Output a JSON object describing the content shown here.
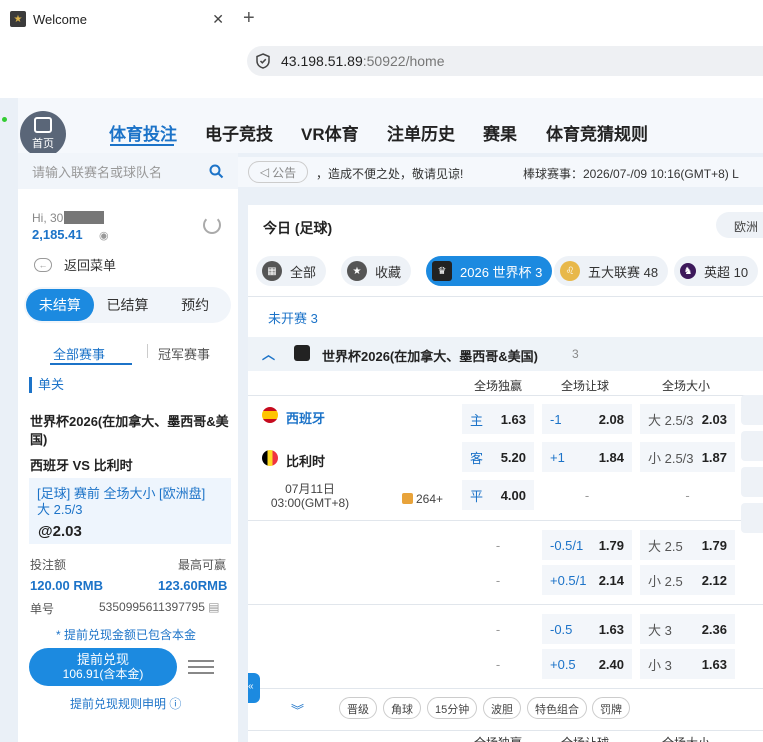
{
  "browser": {
    "tab_title": "Welcome",
    "url_host": "43.198.51.89",
    "url_rest": ":50922/home"
  },
  "nav": {
    "home": "首页",
    "items": [
      "体育投注",
      "电子竞技",
      "VR体育",
      "注单历史",
      "赛果",
      "体育竞猜规则"
    ]
  },
  "sidebar": {
    "search_placeholder": "请输入联赛名或球队名",
    "greeting": "Hi, 30",
    "balance": "2,185.41",
    "back_menu": "返回菜单",
    "seg": [
      "未结算",
      "已结算",
      "预约"
    ],
    "subtabs": [
      "全部赛事",
      "冠军赛事"
    ],
    "bet": {
      "type": "单关",
      "league": "世界杯2026(在加拿大、墨西哥&美国)",
      "match": "西班牙 VS 比利时",
      "sel_line1": "[足球] 赛前 全场大小 [欧洲盘]",
      "sel_line2": "大 2.5/3",
      "odds": "@2.03",
      "stake_label": "投注额",
      "max_label": "最高可赢",
      "stake": "120.00 RMB",
      "max": "123.60RMB",
      "ticket_label": "单号",
      "ticket": "5350995611397795",
      "note": "* 提前兑现金额已包含本金",
      "cashout_a": "提前兑现",
      "cashout_b": "106.91(含本金)",
      "rules": "提前兑现规则申明"
    }
  },
  "main": {
    "notice": "公告",
    "marquee": "，造成不便之处，敬请见谅!",
    "marquee2": "棒球赛事：2026/07-/09 10:16(GMT+8) L",
    "today": "今日 (足球)",
    "lang": "欧洲",
    "filters": [
      {
        "label": "全部",
        "icon": "grid-icon"
      },
      {
        "label": "收藏",
        "icon": "star-icon"
      },
      {
        "label": "2026 世界杯 3",
        "icon": "trophy-icon"
      },
      {
        "label": "五大联赛 48",
        "icon": "lion-icon"
      },
      {
        "label": "英超 10",
        "icon": "premier-league-icon"
      }
    ],
    "upcoming": "未开赛 3",
    "tournament": {
      "name": "世界杯2026(在加拿大、墨西哥&美国)",
      "count": "3"
    },
    "columns": [
      "全场独赢",
      "全场让球",
      "全场大小"
    ],
    "match1": {
      "home": "西班牙",
      "away": "比利时",
      "date": "07月11日",
      "time": "03:00(GMT+8)",
      "more": "264+",
      "rows": [
        {
          "k1": "主",
          "v1": "1.63",
          "k2": "-1",
          "v2": "2.08",
          "k3": "大 2.5/3",
          "v3": "2.03"
        },
        {
          "k1": "客",
          "v1": "5.20",
          "k2": "+1",
          "v2": "1.84",
          "k3": "小 2.5/3",
          "v3": "1.87"
        },
        {
          "k1": "平",
          "v1": "4.00",
          "k2": "",
          "v2": "-",
          "k3": "",
          "v3": "-"
        }
      ]
    },
    "extra_rows": [
      {
        "v1": "-",
        "k2": "-0.5/1",
        "v2": "1.79",
        "k3": "大 2.5",
        "v3": "1.79"
      },
      {
        "v1": "-",
        "k2": "+0.5/1",
        "v2": "2.14",
        "k3": "小 2.5",
        "v3": "2.12"
      },
      {
        "v1": "-",
        "k2": "-0.5",
        "v2": "1.63",
        "k3": "大 3",
        "v3": "2.36"
      },
      {
        "v1": "-",
        "k2": "+0.5",
        "v2": "2.40",
        "k3": "小 3",
        "v3": "1.63"
      }
    ],
    "tags": [
      "晋级",
      "角球",
      "15分钟",
      "波胆",
      "特色组合",
      "罚牌"
    ],
    "columns_bottom": [
      "全场独赢",
      "全场让球",
      "全场大小"
    ]
  }
}
